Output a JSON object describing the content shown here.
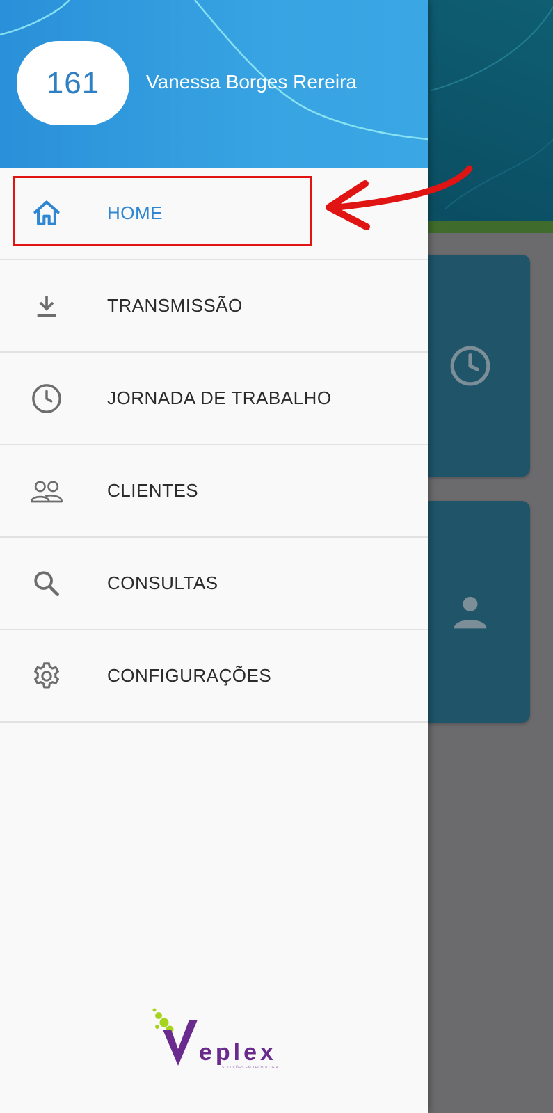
{
  "drawer": {
    "user": {
      "id": "161",
      "name": "Vanessa Borges Rereira"
    },
    "menu": [
      {
        "label": "HOME",
        "icon": "home-icon",
        "active": true
      },
      {
        "label": "TRANSMISSÃO",
        "icon": "download-icon",
        "active": false
      },
      {
        "label": "JORNADA DE TRABALHO",
        "icon": "clock-icon",
        "active": false
      },
      {
        "label": "CLIENTES",
        "icon": "people-icon",
        "active": false
      },
      {
        "label": "CONSULTAS",
        "icon": "search-icon",
        "active": false
      },
      {
        "label": "CONFIGURAÇÕES",
        "icon": "gear-icon",
        "active": false
      }
    ],
    "logo": {
      "initial": "V",
      "letters": "eplex",
      "tagline": "SOLUÇÕES EM TECNOLOGIA"
    }
  },
  "background_cards": [
    {
      "icon": "clock-icon"
    },
    {
      "icon": "person-icon"
    }
  ],
  "colors": {
    "header_blue": "#37a3e2",
    "active_blue": "#2f86d2",
    "annotation_red": "#e11414",
    "background_card": "#1f5469",
    "logo_purple": "#6b2a8d",
    "logo_green": "#a6d41e"
  }
}
